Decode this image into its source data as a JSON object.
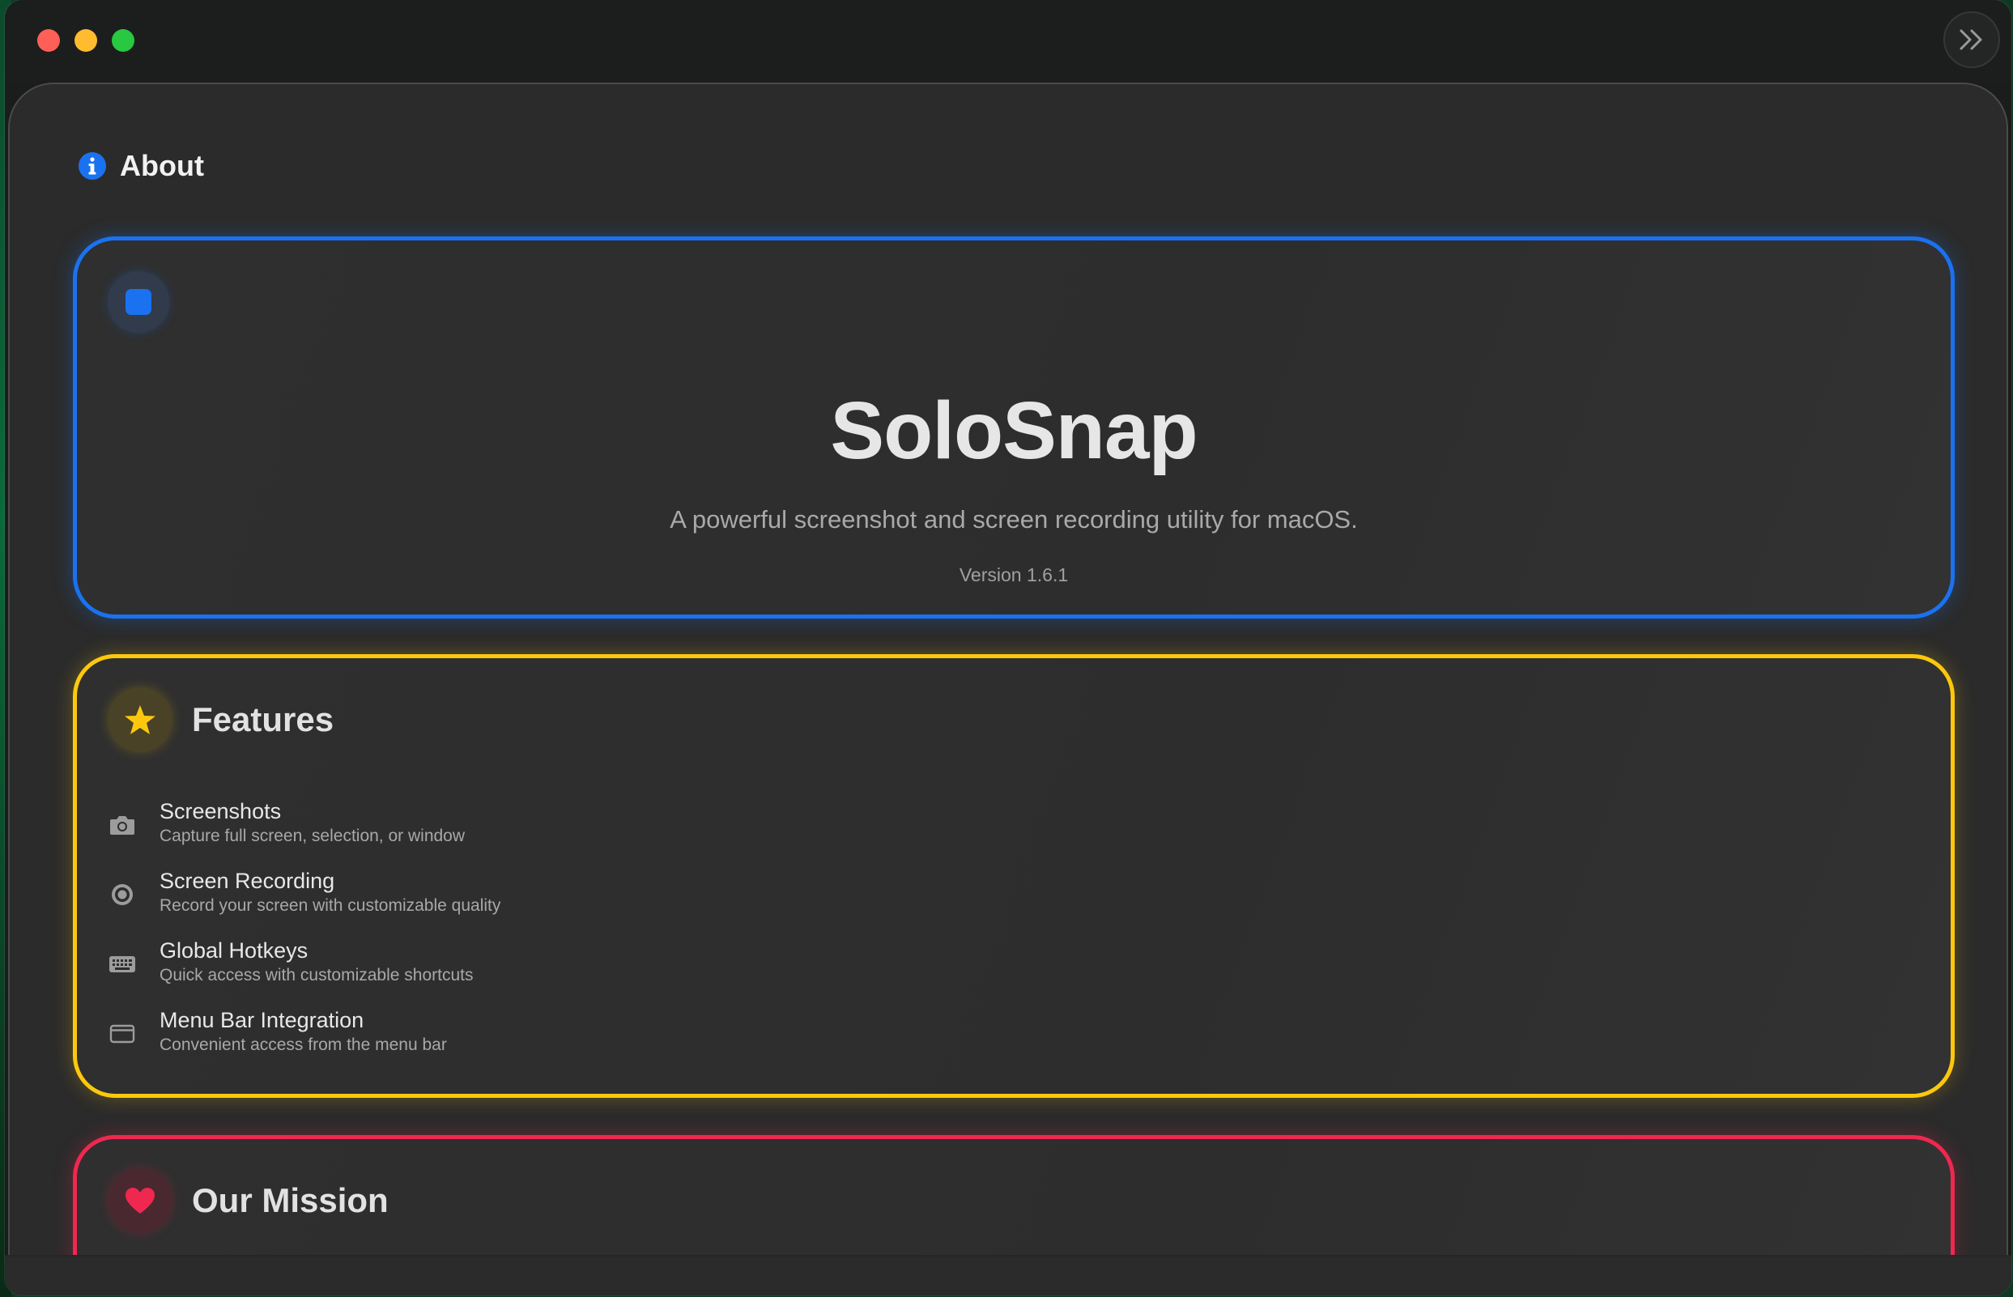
{
  "window": {
    "sidebar_toggle_icon": "chevron-double-right-icon"
  },
  "page": {
    "title": "About",
    "title_icon": "info-circle-icon"
  },
  "hero": {
    "app_name": "SoloSnap",
    "tagline": "A powerful screenshot and screen recording utility for macOS.",
    "version": "Version 1.6.1",
    "accent_color": "#1a72f0"
  },
  "features": {
    "title": "Features",
    "icon": "star-icon",
    "accent_color": "#fcc80d",
    "items": [
      {
        "name": "Screenshots",
        "description": "Capture full screen, selection, or window",
        "icon": "camera-icon"
      },
      {
        "name": "Screen Recording",
        "description": "Record your screen with customizable quality",
        "icon": "record-circle-icon"
      },
      {
        "name": "Global Hotkeys",
        "description": "Quick access with customizable shortcuts",
        "icon": "keyboard-icon"
      },
      {
        "name": "Menu Bar Integration",
        "description": "Convenient access from the menu bar",
        "icon": "menubar-window-icon"
      }
    ]
  },
  "mission": {
    "title": "Our Mission",
    "icon": "heart-icon",
    "accent_color": "#ef2850"
  }
}
